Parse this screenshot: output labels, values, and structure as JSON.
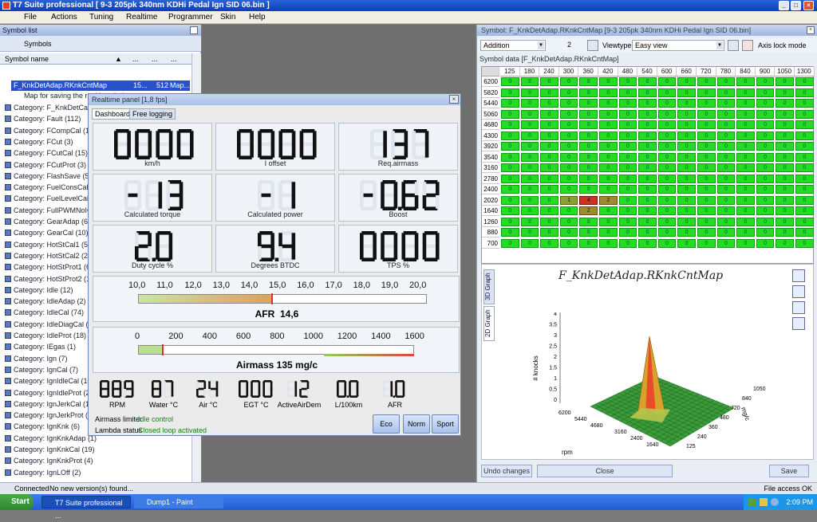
{
  "window": {
    "title": "T7 Suite professional [ 9-3 205pk 340nm KDHi Pedal Ign SID 06.bin ]"
  },
  "menu": [
    "File",
    "Actions",
    "Tuning",
    "Realtime",
    "Programmer",
    "Skin",
    "Help"
  ],
  "symbol_list": {
    "header": "Symbol list",
    "tab": "Symbols",
    "columns": [
      "Symbol name",
      "...",
      "...",
      "..."
    ],
    "selected": {
      "name": "F_KnkDetAdap.RKnkCntMap",
      "c2": "15...",
      "c3": "512",
      "c4": "Map..."
    },
    "note": "Map for saving the real knock detect...",
    "categories": [
      "Category: F_KnkDetCal (18)",
      "Category: Fault (112)",
      "Category: FCompCal (1)",
      "Category: FCut (3)",
      "Category: FCutCal (15)",
      "Category: FCutProt (3)",
      "Category: FlashSave (5)",
      "Category: FuelConsCal (6)",
      "Category: FuelLevelCal (12)",
      "Category: FullPWMNoICal (1)",
      "Category: GearAdap (6)",
      "Category: GearCal (10)",
      "Category: HotStCal1 (5)",
      "Category: HotStCal2 (2)",
      "Category: HotStProt1 (6)",
      "Category: HotStProt2 (1)",
      "Category: Idle (12)",
      "Category: IdleAdap (2)",
      "Category: IdleCal (74)",
      "Category: IdleDiagCal (5)",
      "Category: IdleProt (18)",
      "Category: IEgas (1)",
      "Category: Ign (7)",
      "Category: IgnCal (7)",
      "Category: IgnIdleCal (10)",
      "Category: IgnIdleProt (2)",
      "Category: IgnJerkCal (12)",
      "Category: IgnJerkProt (2)",
      "Category: IgnKnk (6)",
      "Category: IgnKnkAdap (1)",
      "Category: IgnKnkCal (19)",
      "Category: IgnKnkProt (4)",
      "Category: IgnLOff (2)"
    ]
  },
  "symbol_panel": {
    "header": "Symbol: F_KnkDetAdap.RKnkCntMap [9-3 205pk 340nm KDHi Pedal Ign SID 06.bin]",
    "operation": "Addition",
    "value": "2",
    "viewtype_label": "Viewtype",
    "viewtype": "Easy view",
    "axis_lock": "Axis lock mode",
    "data_label": "Symbol data [F_KnkDetAdap.RKnkCntMap]",
    "col_headers": [
      "125",
      "180",
      "240",
      "300",
      "360",
      "420",
      "480",
      "540",
      "600",
      "660",
      "720",
      "780",
      "840",
      "900",
      "1050",
      "1300"
    ],
    "row_headers": [
      "6200",
      "5820",
      "5440",
      "5060",
      "4680",
      "4300",
      "3920",
      "3540",
      "3160",
      "2780",
      "2400",
      "2020",
      "1640",
      "1260",
      "880",
      "700"
    ],
    "values": [
      [
        0,
        0,
        0,
        0,
        0,
        0,
        0,
        0,
        0,
        0,
        0,
        0,
        0,
        0,
        0,
        0
      ],
      [
        0,
        0,
        0,
        0,
        0,
        0,
        0,
        0,
        0,
        0,
        0,
        0,
        0,
        0,
        0,
        0
      ],
      [
        0,
        0,
        0,
        0,
        0,
        0,
        0,
        0,
        0,
        0,
        0,
        0,
        0,
        0,
        0,
        0
      ],
      [
        0,
        0,
        0,
        0,
        0,
        0,
        0,
        0,
        0,
        0,
        0,
        0,
        0,
        0,
        0,
        0
      ],
      [
        0,
        0,
        0,
        0,
        0,
        0,
        0,
        0,
        0,
        0,
        0,
        0,
        0,
        0,
        0,
        0
      ],
      [
        0,
        0,
        0,
        0,
        0,
        0,
        0,
        0,
        0,
        0,
        0,
        0,
        0,
        0,
        0,
        0
      ],
      [
        0,
        0,
        0,
        0,
        0,
        0,
        0,
        0,
        0,
        0,
        0,
        0,
        0,
        0,
        0,
        0
      ],
      [
        0,
        0,
        0,
        0,
        0,
        0,
        0,
        0,
        0,
        0,
        0,
        0,
        0,
        0,
        0,
        0
      ],
      [
        0,
        0,
        0,
        0,
        0,
        0,
        0,
        0,
        0,
        0,
        0,
        0,
        0,
        0,
        0,
        0
      ],
      [
        0,
        0,
        0,
        0,
        0,
        0,
        0,
        0,
        0,
        0,
        0,
        0,
        0,
        0,
        0,
        0
      ],
      [
        0,
        0,
        0,
        0,
        0,
        0,
        0,
        0,
        0,
        0,
        0,
        0,
        0,
        0,
        0,
        0
      ],
      [
        0,
        0,
        0,
        1,
        4,
        2,
        0,
        0,
        0,
        0,
        0,
        0,
        0,
        0,
        0,
        0
      ],
      [
        0,
        0,
        0,
        0,
        2,
        0,
        0,
        0,
        0,
        0,
        0,
        0,
        0,
        0,
        0,
        0
      ],
      [
        0,
        0,
        0,
        0,
        0,
        0,
        0,
        0,
        0,
        0,
        0,
        0,
        0,
        0,
        0,
        0
      ],
      [
        0,
        0,
        0,
        0,
        0,
        0,
        0,
        0,
        0,
        0,
        0,
        0,
        0,
        0,
        0,
        0
      ],
      [
        0,
        0,
        0,
        0,
        0,
        0,
        0,
        0,
        0,
        0,
        0,
        0,
        0,
        0,
        0,
        0
      ]
    ],
    "graph_tabs": [
      "3D Graph",
      "2D Graph"
    ],
    "graph_title": "F_KnkDetAdap.RKnkCntMap",
    "z_label": "# knocks",
    "z_ticks": [
      "4",
      "3,5",
      "3",
      "2,5",
      "2",
      "1,5",
      "1",
      "0,5",
      "0"
    ],
    "rpm_label": "rpm",
    "rpm_ticks": [
      "6200",
      "5440",
      "4680",
      "3160",
      "2400",
      "1640"
    ],
    "mgc_label": "mg/c",
    "mgc_ticks": [
      "1050",
      "840",
      "720",
      "480",
      "360",
      "240",
      "125"
    ],
    "buttons": {
      "undo": "Undo changes",
      "close": "Close",
      "save": "Save"
    }
  },
  "realtime": {
    "header": "Realtime panel [1,8 fps]",
    "tabs": [
      "Dashboard",
      "Free logging"
    ],
    "gauges": [
      {
        "value": "0000",
        "label": "km/h"
      },
      {
        "value": "0000",
        "label": "I offset"
      },
      {
        "value": "137",
        "label": "Req.airmass"
      },
      {
        "value": "-13",
        "label": "Calculated torque"
      },
      {
        "value": "-1",
        "label": "Calculated power"
      },
      {
        "value": "-0.62",
        "label": "Boost"
      },
      {
        "value": "2.0",
        "label": "Duty cycle %"
      },
      {
        "value": "9.4",
        "label": "Degrees BTDC"
      },
      {
        "value": "0000",
        "label": "TPS %"
      }
    ],
    "afr_scale": [
      "10,0",
      "11,0",
      "12,0",
      "13,0",
      "14,0",
      "15,0",
      "16,0",
      "17,0",
      "18,0",
      "19,0",
      "20,0"
    ],
    "afr_label": "AFR",
    "afr_value": "14,6",
    "airmass_scale": [
      "0",
      "200",
      "400",
      "600",
      "800",
      "1000",
      "1200",
      "1400",
      "1600"
    ],
    "airmass_label": "Airmass",
    "airmass_value": "135 mg/c",
    "small": [
      {
        "value": "889",
        "label": "RPM"
      },
      {
        "value": "87",
        "label": "Water °C"
      },
      {
        "value": "24",
        "label": "Air °C"
      },
      {
        "value": "000",
        "label": "EGT °C"
      },
      {
        "value": "12",
        "label": "ActiveAirDem"
      },
      {
        "value": "0.0",
        "label": "L/100km"
      },
      {
        "value": "1.0",
        "label": "AFR"
      }
    ],
    "airmass_limiter_label": "Airmass limiter",
    "airmass_limiter": "Idle control",
    "lambda_label": "Lambda status",
    "lambda": "Closed loop activated",
    "buttons": [
      "Eco",
      "Norm",
      "Sport"
    ]
  },
  "status": {
    "left": "Connected",
    "message": "No new version(s) found...",
    "right": "File access OK"
  },
  "taskbar": {
    "start": "Start",
    "tasks": [
      "T7 Suite professional ...",
      "Dump1 - Paint"
    ],
    "clock": "2:09 PM"
  }
}
